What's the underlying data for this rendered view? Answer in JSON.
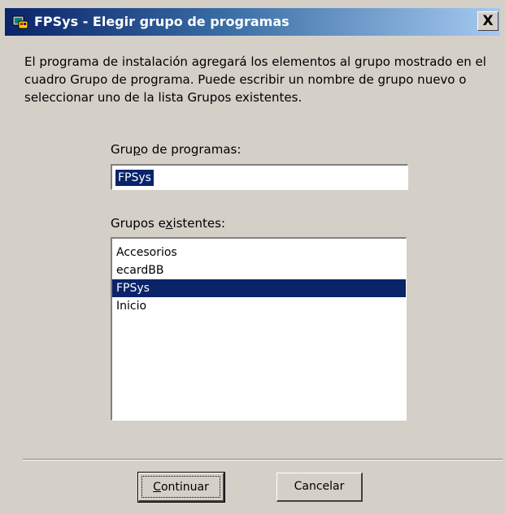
{
  "window": {
    "title": "FPSys - Elegir grupo de programas",
    "close_label": "X"
  },
  "description": "El programa de instalación agregará los elementos al grupo mostrado en el cuadro Grupo de programa. Puede escribir un nombre de grupo nuevo o seleccionar uno de la lista Grupos existentes.",
  "program_group": {
    "label_before": "Gru",
    "label_accel": "p",
    "label_after": "o de programas:",
    "value": "FPSys"
  },
  "existing_groups": {
    "label_before": "Grupos e",
    "label_accel": "x",
    "label_after": "istentes:",
    "items": [
      "Accesorios",
      "ecardBB",
      "FPSys",
      "Inicio"
    ],
    "selected_index": 2
  },
  "buttons": {
    "continue_accel": "C",
    "continue_rest": "ontinuar",
    "cancel_label": "Cancelar"
  },
  "colors": {
    "titlebar_start": "#0a246a",
    "titlebar_end": "#a6caf0",
    "selection": "#0a246a",
    "face": "#d4d0c8"
  }
}
